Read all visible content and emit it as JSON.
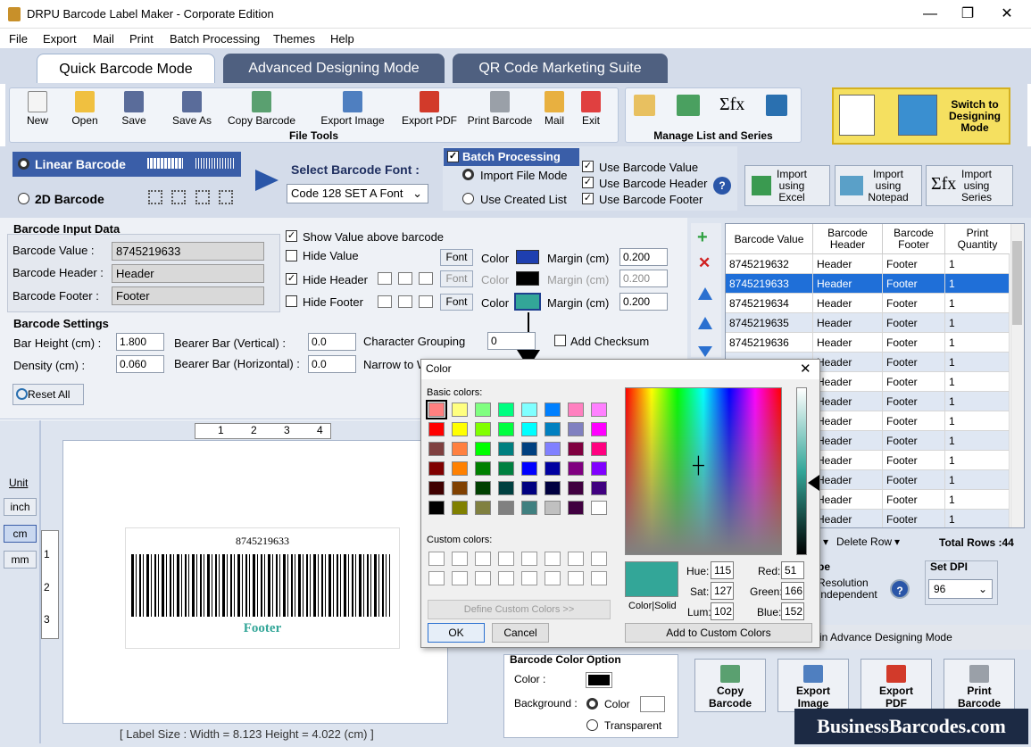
{
  "window": {
    "title": "DRPU Barcode Label Maker - Corporate Edition",
    "minimize": "—",
    "maximize": "❐",
    "close": "✕"
  },
  "menu": [
    "File",
    "Export",
    "Mail",
    "Print",
    "Batch Processing",
    "Themes",
    "Help"
  ],
  "tabs": [
    "Quick Barcode Mode",
    "Advanced Designing Mode",
    "QR Code Marketing Suite"
  ],
  "file_tools": {
    "label": "File Tools",
    "buttons": [
      "New",
      "Open",
      "Save",
      "Save As",
      "Copy Barcode",
      "Export Image",
      "Export PDF",
      "Print Barcode",
      "Mail",
      "Exit"
    ]
  },
  "manage": {
    "label": "Manage List and Series",
    "sigma": "Σfx"
  },
  "switch_mode": {
    "line1": "Switch to",
    "line2": "Designing",
    "line3": "Mode"
  },
  "barcode_type": {
    "linear": "Linear Barcode",
    "twod": "2D Barcode"
  },
  "font_select": {
    "label": "Select Barcode Font :",
    "value": "Code 128 SET A Font"
  },
  "batch": {
    "title": "Batch Processing",
    "import_file": "Import File Mode",
    "use_created": "Use Created List",
    "use_value": "Use Barcode Value",
    "use_header": "Use Barcode Header",
    "use_footer": "Use Barcode Footer",
    "help": "?"
  },
  "imports": [
    {
      "l1": "Import",
      "l2": "using",
      "l3": "Excel"
    },
    {
      "l1": "Import",
      "l2": "using",
      "l3": "Notepad"
    },
    {
      "l1": "Import",
      "l2": "using",
      "l3": "Series"
    }
  ],
  "input": {
    "title": "Barcode Input Data",
    "value_label": "Barcode Value :",
    "value": "8745219633",
    "header_label": "Barcode Header :",
    "header": "Header",
    "footer_label": "Barcode Footer :",
    "footer": "Footer",
    "show_above": "Show Value above barcode",
    "hide_value": "Hide Value",
    "hide_header": "Hide Header",
    "hide_footer": "Hide Footer",
    "font": "Font",
    "color": "Color",
    "margin": "Margin (cm)",
    "margin1": "0.200",
    "margin2": "0.200",
    "margin3": "0.200"
  },
  "settings": {
    "title": "Barcode Settings",
    "bar_height_label": "Bar Height (cm) :",
    "bar_height": "1.800",
    "density_label": "Density (cm) :",
    "density": "0.060",
    "bearer_v_label": "Bearer Bar (Vertical) :",
    "bearer_v": "0.0",
    "bearer_h_label": "Bearer Bar (Horizontal) :",
    "bearer_h": "0.0",
    "char_group_label": "Character Grouping",
    "char_group": "0",
    "narrow_label": "Narrow to W",
    "checksum": "Add Checksum",
    "reset": "Reset All"
  },
  "canvas": {
    "unit": "Unit",
    "inch": "inch",
    "cm": "cm",
    "mm": "mm",
    "ruler_top": [
      "1",
      "2",
      "3",
      "4"
    ],
    "ruler_left": [
      "1",
      "2",
      "3"
    ],
    "barcode_value": "8745219633",
    "barcode_footer": "Footer",
    "status": "[ Label Size : Width = 8.123  Height = 4.022 (cm) ]"
  },
  "grid": {
    "headers": [
      "Barcode Value",
      "Barcode Header",
      "Barcode Footer",
      "Print Quantity"
    ],
    "rows": [
      [
        "8745219632",
        "Header",
        "Footer",
        "1"
      ],
      [
        "8745219633",
        "Header",
        "Footer",
        "1"
      ],
      [
        "8745219634",
        "Header",
        "Footer",
        "1"
      ],
      [
        "8745219635",
        "Header",
        "Footer",
        "1"
      ],
      [
        "8745219636",
        "Header",
        "Footer",
        "1"
      ],
      [
        "",
        "Header",
        "Footer",
        "1"
      ],
      [
        "",
        "Header",
        "Footer",
        "1"
      ],
      [
        "",
        "Header",
        "Footer",
        "1"
      ],
      [
        "",
        "Header",
        "Footer",
        "1"
      ],
      [
        "",
        "Header",
        "Footer",
        "1"
      ],
      [
        "",
        "Header",
        "Footer",
        "1"
      ],
      [
        "",
        "Header",
        "Footer",
        "1"
      ],
      [
        "",
        "Header",
        "Footer",
        "1"
      ],
      [
        "",
        "Header",
        "Footer",
        "1"
      ]
    ],
    "delete_row": "Delete Row",
    "total_rows": "Total Rows :44"
  },
  "type_frag": {
    "t1": "pe",
    "r1": "Resolution",
    "r2": "Independent"
  },
  "dpi": {
    "label": "Set DPI",
    "value": "96"
  },
  "advance_hint": "in Advance Designing Mode",
  "color_option": {
    "title": "Barcode Color Option",
    "color": "Color :",
    "background": "Background :",
    "bg_color": "Color",
    "transparent": "Transparent"
  },
  "bottom_buttons": [
    {
      "l1": "Copy",
      "l2": "Barcode"
    },
    {
      "l1": "Export",
      "l2": "Image"
    },
    {
      "l1": "Export",
      "l2": "PDF"
    },
    {
      "l1": "Print",
      "l2": "Barcode"
    }
  ],
  "logo": "BusinessBarcodes.com",
  "dialog": {
    "title": "Color",
    "basic": "Basic colors:",
    "custom": "Custom colors:",
    "define": "Define Custom Colors >>",
    "ok": "OK",
    "cancel": "Cancel",
    "colorsolid": "Color|Solid",
    "hue_l": "Hue:",
    "hue": "115",
    "sat_l": "Sat:",
    "sat": "127",
    "lum_l": "Lum:",
    "lum": "102",
    "red_l": "Red:",
    "red": "51",
    "green_l": "Green:",
    "green": "166",
    "blue_l": "Blue:",
    "blue": "152",
    "add": "Add to Custom Colors",
    "swatches": [
      "#ff8080",
      "#ffff80",
      "#80ff80",
      "#00ff80",
      "#80ffff",
      "#0080ff",
      "#ff80c0",
      "#ff80ff",
      "#ff0000",
      "#ffff00",
      "#80ff00",
      "#00ff40",
      "#00ffff",
      "#0080c0",
      "#8080c0",
      "#ff00ff",
      "#804040",
      "#ff8040",
      "#00ff00",
      "#008080",
      "#004080",
      "#8080ff",
      "#800040",
      "#ff0080",
      "#800000",
      "#ff8000",
      "#008000",
      "#008040",
      "#0000ff",
      "#0000a0",
      "#800080",
      "#8000ff",
      "#400000",
      "#804000",
      "#004000",
      "#004040",
      "#000080",
      "#000040",
      "#400040",
      "#400080",
      "#000000",
      "#808000",
      "#808040",
      "#808080",
      "#408080",
      "#c0c0c0",
      "#400040",
      "#ffffff"
    ],
    "selected_color": "#33a698"
  },
  "colors": {
    "accent": "#3a5ea8",
    "teal": "#33a698",
    "tabInactive": "#4f6080"
  }
}
